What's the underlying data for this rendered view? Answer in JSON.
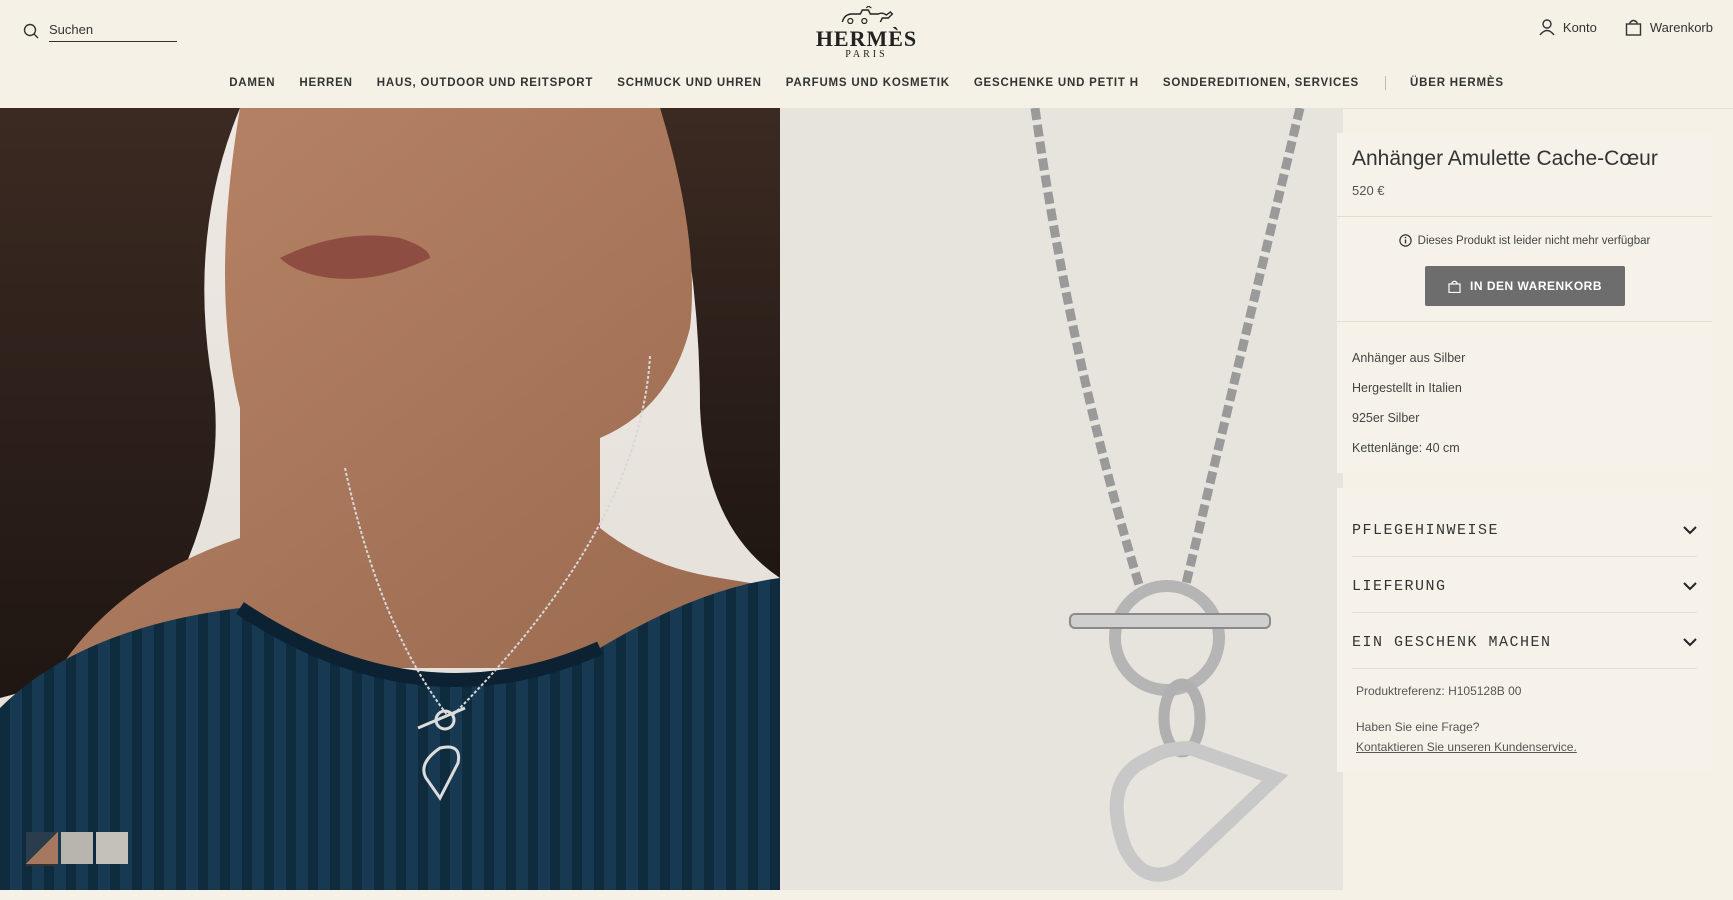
{
  "header": {
    "search": {
      "placeholder": "Suchen",
      "icon": "search-icon"
    },
    "logo": {
      "wordmark": "HERMÈS",
      "sub": "PARIS"
    },
    "account_label": "Konto",
    "cart_label": "Warenkorb"
  },
  "nav": {
    "items": [
      "DAMEN",
      "HERREN",
      "HAUS, OUTDOOR UND REITSPORT",
      "SCHMUCK UND UHREN",
      "PARFUMS UND KOSMETIK",
      "GESCHENKE UND PETIT H",
      "SONDEREDITIONEN, SERVICES"
    ],
    "about": "ÜBER HERMÈS"
  },
  "product": {
    "title": "Anhänger Amulette Cache-Cœur",
    "price": "520 €",
    "availability": "Dieses Produkt ist leider nicht mehr verfügbar",
    "add_to_cart": "IN DEN WARENKORB",
    "details": [
      "Anhänger aus Silber",
      "Hergestellt in Italien",
      "925er Silber",
      "Kettenlänge: 40 cm"
    ]
  },
  "accordion": {
    "care": "PFLEGEHINWEISE",
    "delivery": "LIEFERUNG",
    "gift": "EIN GESCHENK MACHEN"
  },
  "reference": {
    "label": "Produktreferenz:",
    "value": "H105128B 00"
  },
  "help": {
    "question": "Haben Sie eine Frage?",
    "contact": "Kontaktieren Sie unseren Kundenservice."
  },
  "colors": {
    "background": "#f6f1e7",
    "button": "#6d6d6d",
    "sweater": "#173a52"
  }
}
